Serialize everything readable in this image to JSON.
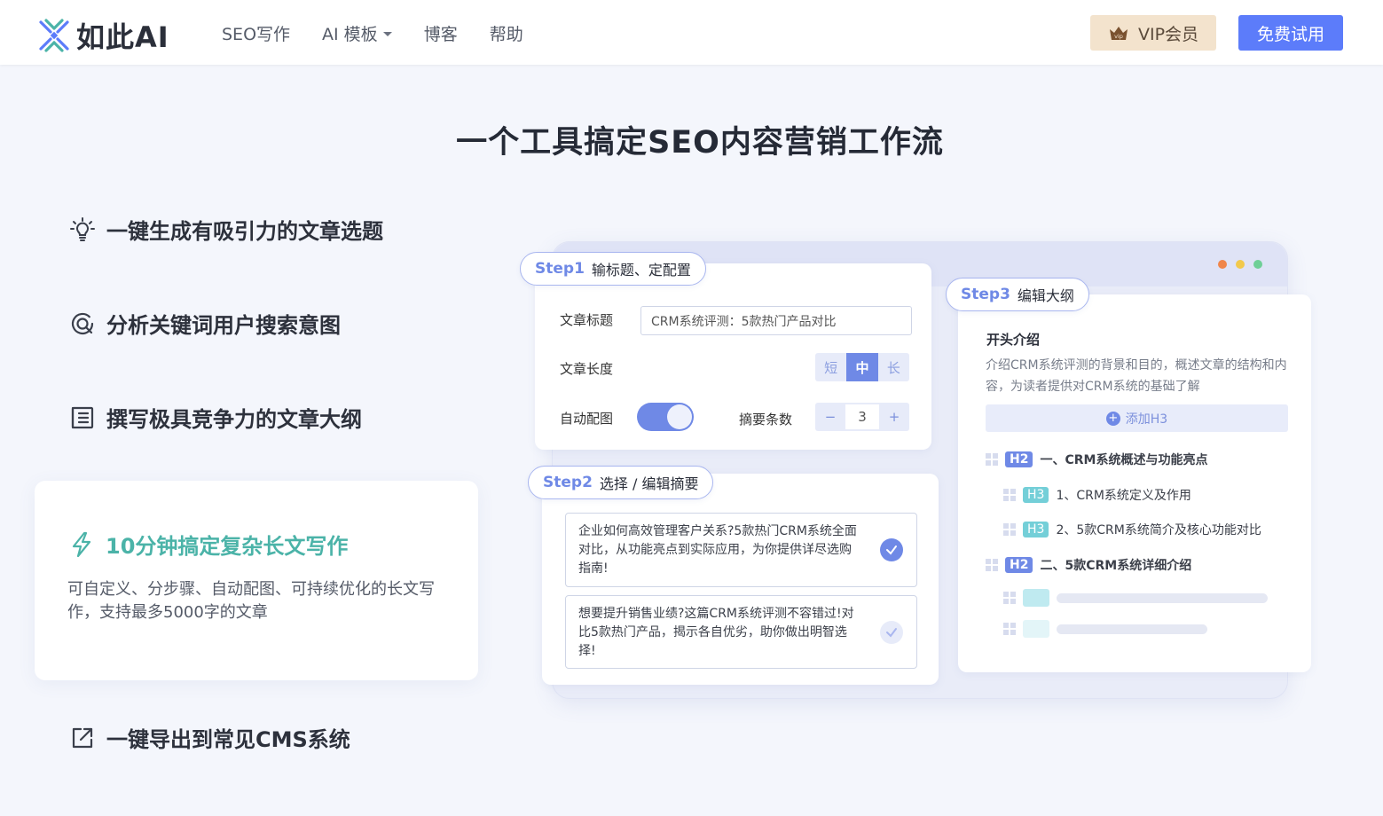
{
  "header": {
    "logo_text": "如此AI",
    "nav": [
      {
        "label": "SEO写作",
        "has_caret": false
      },
      {
        "label": "AI 模板",
        "has_caret": true
      },
      {
        "label": "博客",
        "has_caret": false
      },
      {
        "label": "帮助",
        "has_caret": false
      }
    ],
    "vip_label": "VIP会员",
    "vip_icon_text": "vip",
    "trial_label": "免费试用",
    "accent_color": "#5c7cfa"
  },
  "section_title": "一个工具搞定SEO内容营销工作流",
  "features": [
    {
      "label": "一键生成有吸引力的文章选题",
      "icon": "lightbulb-icon"
    },
    {
      "label": "分析关键词用户搜索意图",
      "icon": "target-search-icon"
    },
    {
      "label": "撰写极具竞争力的文章大纲",
      "icon": "outline-list-icon"
    },
    {
      "label": "10分钟搞定复杂长文写作",
      "icon": "lightning-icon",
      "active": true,
      "desc": "可自定义、分步骤、自动配图、可持续优化的长文写作，支持最多5000字的文章"
    },
    {
      "label": "一键导出到常见CMS系统",
      "icon": "export-icon"
    }
  ],
  "step1": {
    "step_no": "Step1",
    "step_title": "输标题、定配置",
    "title_label": "文章标题",
    "title_value": "CRM系统评测：5款热门产品对比",
    "length_label": "文章长度",
    "length_options": [
      "短",
      "中",
      "长"
    ],
    "length_selected": "中",
    "auto_image_label": "自动配图",
    "auto_image_on": true,
    "summary_count_label": "摘要条数",
    "summary_count_minus": "−",
    "summary_count_value": "3",
    "summary_count_plus": "+"
  },
  "step2": {
    "step_no": "Step2",
    "step_title": "选择 / 编辑摘要",
    "abstracts": [
      {
        "text": "企业如何高效管理客户关系?5款热门CRM系统全面对比，从功能亮点到实际应用，为你提供详尽选购指南!",
        "selected": true
      },
      {
        "text": "想要提升销售业绩?这篇CRM系统评测不容错过!对比5款热门产品，揭示各自优劣，助你做出明智选择!",
        "selected": false
      }
    ]
  },
  "step3": {
    "step_no": "Step3",
    "step_title": "编辑大纲",
    "intro_heading": "开头介绍",
    "intro_desc": "介绍CRM系统评测的背景和目的，概述文章的结构和内容，为读者提供对CRM系统的基础了解",
    "add_h3_label": "添加H3",
    "add_h3_icon": "+",
    "outline": [
      {
        "tag": "H2",
        "text": "一、CRM系统概述与功能亮点"
      },
      {
        "tag": "H3",
        "text": "1、CRM系统定义及作用"
      },
      {
        "tag": "H3",
        "text": "2、5款CRM系统简介及核心功能对比"
      },
      {
        "tag": "H2",
        "text": "二、5款CRM系统详细介绍"
      }
    ]
  },
  "colors": {
    "window_dots": [
      "#f0864a",
      "#f2c94c",
      "#6fcf97"
    ],
    "active_feature": "#4bb3a8",
    "step_accent": "#6f89e6"
  }
}
